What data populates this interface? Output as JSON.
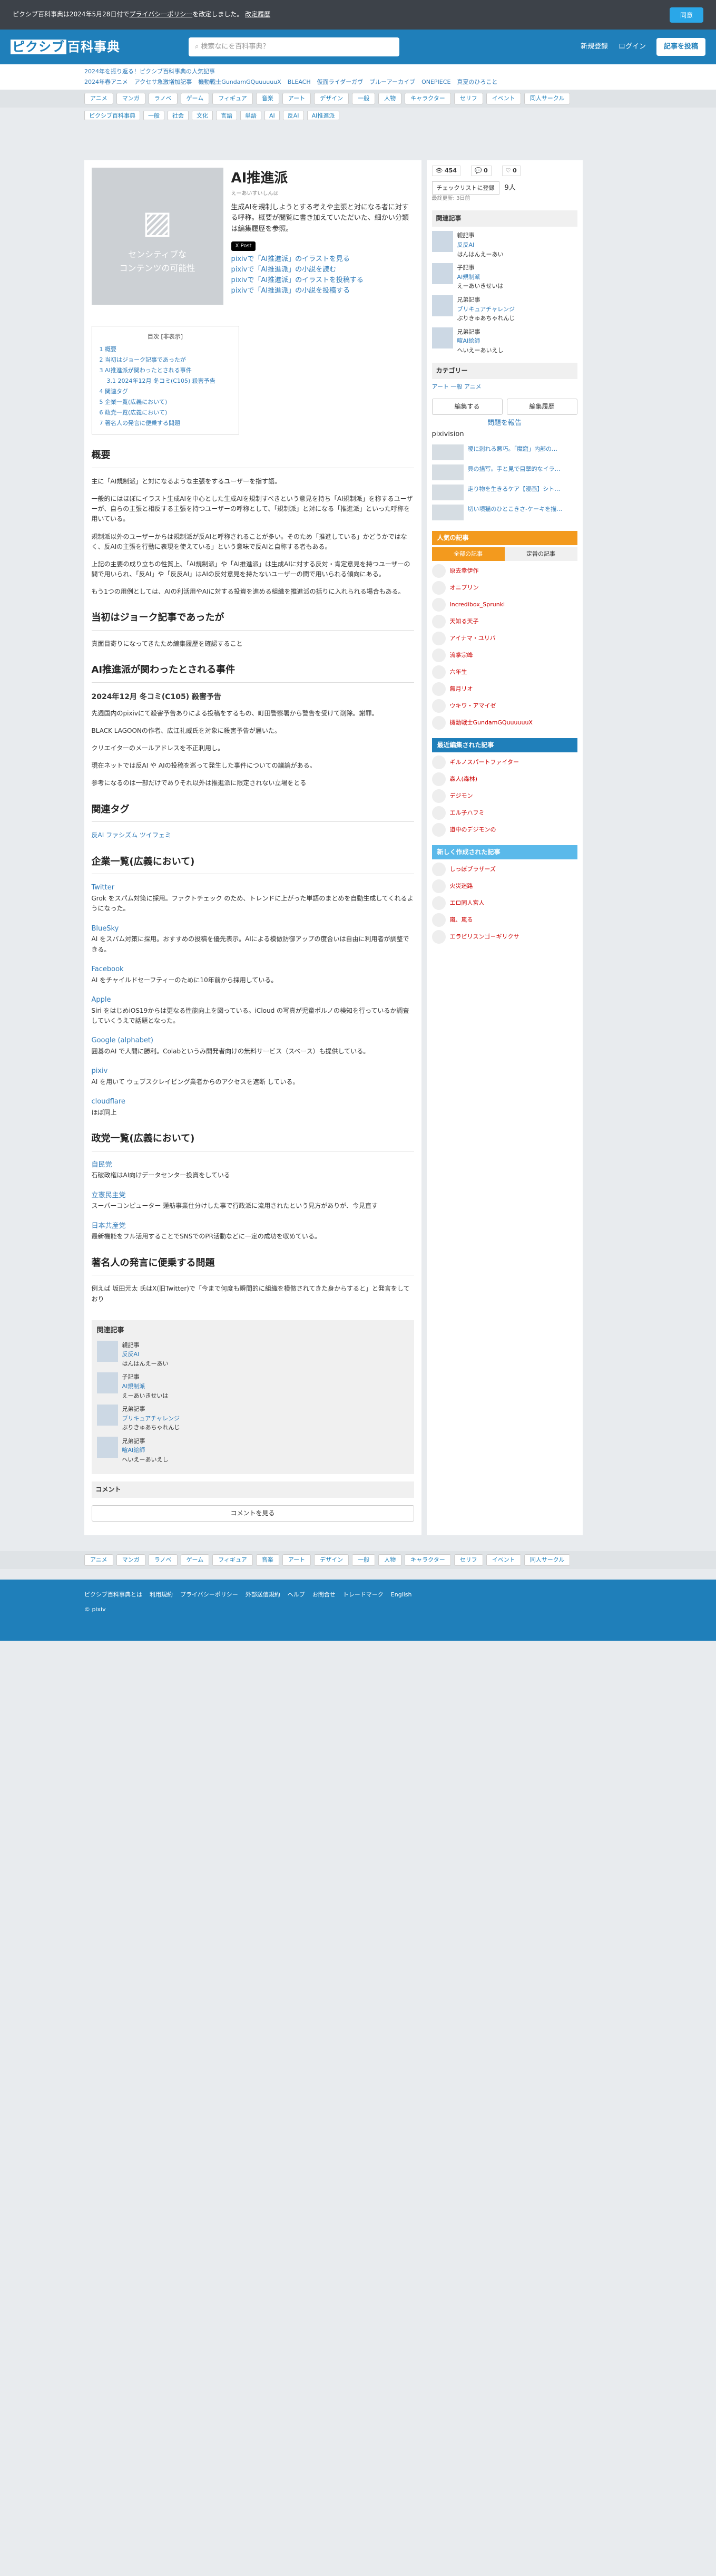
{
  "notice": {
    "text": "ピクシブ百科事典は2024年5月28日付で",
    "link": "プライバシーポリシー",
    "text2": "を改定しました。",
    "more": "改定履歴",
    "ok": "同意"
  },
  "header": {
    "logo": "ピクシブ百科事典",
    "search_placeholder": "検索なにを百科事典？",
    "login": "ログイン",
    "new": "新規登録",
    "register": "記事を投稿"
  },
  "promo": {
    "line1": "2024年を振り返る！ピクシブ百科事典の人気記事",
    "line2": [
      "2024年春アニメ",
      "アクセサ急激増加記事",
      "機動戦士GundamGQuuuuuuX",
      "BLEACH",
      "仮面ライダーガヴ",
      "ブルーアーカイブ",
      "ONEPIECE",
      "真夏のひろこと"
    ]
  },
  "nav": [
    "アニメ",
    "マンガ",
    "ラノベ",
    "ゲーム",
    "フィギュア",
    "音楽",
    "アート",
    "デザイン",
    "一般",
    "人物",
    "キャラクター",
    "セリフ",
    "イベント",
    "同人サークル"
  ],
  "breadcrumb": [
    "ピクシブ百科事典",
    "一般",
    "社会",
    "文化",
    "言語",
    "単語",
    "AI",
    "反AI",
    "AI推進派"
  ],
  "article": {
    "title": "AI推進派",
    "yomi": "えーあいすいしんは",
    "desc": "生成AIを規制しようとする考えや主張と対になる者に対する呼称。概要が閲覧に書き加えていただいた、細かい分類は編集履歴を参照。",
    "post": "X Post",
    "thumb": "センシティブな\nコンテンツの可能性",
    "links": [
      "pixivで「AI推進派」のイラストを見る",
      "pixivで「AI推進派」の小説を読む",
      "pixivで「AI推進派」のイラストを投稿する",
      "pixivで「AI推進派」の小説を投稿する"
    ]
  },
  "toc": {
    "title": "目次 [非表示]",
    "items": [
      "1 概要",
      "2 当初はジョーク記事であったが",
      "3 AI推進派が関わったとされる事件",
      "3.1 2024年12月 冬コミ(C105) 殺害予告",
      "4 関連タグ",
      "5 企業一覧(広義において)",
      "6 政党一覧(広義において)",
      "7 著名人の発言に便乗する問題"
    ]
  },
  "sections": {
    "s1": "概要",
    "s1p": [
      "主に「AI規制派」と対になるような主張をするユーザーを指す語。",
      "一般的にはほぼにイラスト生成AIを中心とした生成AIを規制すべきという意見を持ち「AI規制派」を称するユーザーが、自らの主張と相反する主張を持つユーザーの呼称として、「規制派」と対になる「推進派」といった呼称を用いている。",
      "規制派以外のユーザーからは規制派が反AIと呼称されることが多い。そのため「推進している」かどうかではなく、反AIの主張を行動に表現を使えている」という意味で反AIと自称する者もある。",
      "上記の主要の成り立ちの性質上、「AI規制派」や「AI推進派」は生成AIに対する反対・肯定意見を持つユーザーの間で用いられ、「反AI」や「反反AI」はAIの反対意見を持たないユーザーの間で用いられる傾向にある。",
      "もう1つの用例としては、AIの利活用やAIに対する投資を進める組織を推進派の括りに入れられる場合もある。"
    ],
    "s2": "当初はジョーク記事であったが",
    "s2p": "真面目寄りになってきたため編集履歴を確認すること",
    "s3": "AI推進派が関わったとされる事件",
    "s31": "2024年12月 冬コミ(C105) 殺害予告",
    "s3p": [
      "先週国内のpixivにて殺害予告ありによる投稿をするもの、町田警察署から警告を受けて削除。謝罪。",
      "BLACK LAGOONの作者、広江礼威氏を対象に殺害予告が届いた。",
      "クリエイターのメールアドレスを不正利用し。",
      "現在ネットでは反AI や AIの投稿を巡って発生した事件についての議論がある。",
      "参考になるのは一部だけでありそれ以外は推進派に限定されない立場をとる"
    ],
    "s4": "関連タグ",
    "s4p": "反AI ファシズム ツイフェミ",
    "s5": "企業一覧(広義において)",
    "s5items": [
      {
        "name": "Twitter",
        "text": "Grok をスパム対策に採用。ファクトチェック のため、トレンドに上がった単語のまとめを自動生成してくれるようになった。"
      },
      {
        "name": "BlueSky",
        "text": "AI をスパム対策に採用。おすすめの投稿を優先表示。AIによる模倣防御アップの度合いは自由に利用者が調整できる。"
      },
      {
        "name": "Facebook",
        "text": "AI をチャイルドセーフティーのために10年前から採用している。"
      },
      {
        "name": "Apple",
        "text": "Siri をはじめiOS19からは更なる性能向上を図っている。iCloud の写真が児童ポルノの検知を行っているか調査していくうえで話題となった。"
      },
      {
        "name": "Google (alphabet)",
        "text": "囲碁のAI で人間に勝利。Colabというみ開発者向けの無料サービス（スペース）も提供している。"
      },
      {
        "name": "pixiv",
        "text": "AI を用いて ウェブスクレイピング業者からのアクセスを遮断 している。"
      },
      {
        "name": "cloudflare",
        "text": "ほぼ同上"
      }
    ],
    "s6": "政党一覧(広義において)",
    "s6items": [
      {
        "name": "自民党",
        "text": "石破政権はAI向けデータセンター投資をしている"
      },
      {
        "name": "立憲民主党",
        "text": "スーパーコンピューター 蓮舫事業仕分けした事で行政派に流用されたという見方がありが、今見直す"
      },
      {
        "name": "日本共産党",
        "text": "最新機能をフル活用することでSNSでのPR活動などに一定の成功を収めている。"
      }
    ],
    "s7": "著名人の発言に便乗する問題",
    "s7p": "例えば 坂田元太 氏はX(旧Twitter)で「今まで何度も瞬間的に組織を模倣されてきた身からすると」と発言をしており"
  },
  "related": {
    "title": "関連記事",
    "items": [
      {
        "tag": "親記事",
        "name": "反反AI",
        "yomi": "はんはんえーあい"
      },
      {
        "tag": "子記事",
        "name": "AI規制派",
        "yomi": "えーあいきせいは"
      },
      {
        "tag": "兄弟記事",
        "name": "ブリキュアチャレンジ",
        "yomi": "ぶりきゅあちゃれんじ"
      },
      {
        "tag": "兄弟記事",
        "name": "喧AI絵師",
        "yomi": "へいえーあいえし"
      }
    ]
  },
  "comment": {
    "title": "コメント",
    "btn": "コメントを見る"
  },
  "side": {
    "views": "454",
    "comments": "0",
    "likes": "0",
    "watch": "チェックリストに登録",
    "watch_count": "9人",
    "updated": "最終更新",
    "date": "3日前",
    "related": "関連記事",
    "cat": "カテゴリー",
    "cats": [
      "アート",
      "一般",
      "アニメ"
    ],
    "edit": "編集する",
    "history": "編集履歴",
    "report": "問題を報告",
    "pixivision": "pixivision",
    "pv": [
      "曖に刺れる悪巧。「魔窟」内部の…",
      "貝の描写。手と見で目撃的なイラ…",
      "走り物を生きるケア【漫画】シト…",
      "切い頃猫のひとこきさ-ケーキを描…"
    ],
    "popular": "人気の記事",
    "ptabs": [
      "全部の記事",
      "定番の記事"
    ],
    "ranking": [
      "原去幸伊作",
      "オニプリン",
      "Incredibox_Sprunki",
      "天知る天子",
      "アイナマ・ユリバ",
      "流拳宗峰",
      "六年生",
      "無月リオ",
      "ウキワ・アマイゼ",
      "機動戦士GundamGQuuuuuuX"
    ],
    "recent": "最近編集された記事",
    "recent_items": [
      "ギルノスパートファイター",
      "森人(森林)",
      "デジモン",
      "エル子ハフミ",
      "道中のデジモンの"
    ],
    "new": "新しく作成された記事",
    "new_items": [
      "しっぽブラザーズ",
      "火災迷路",
      "エロ同人宮人",
      "嵐、嵐る",
      "エラビリスンゴ－ギリクサ"
    ]
  },
  "footer": {
    "btm": [
      "ピクシブ百科事典とは",
      "利用規約",
      "プライバシーポリシー",
      "外部送信規約",
      "ヘルプ",
      "お問合せ",
      "トレードマーク",
      "English"
    ],
    "copy": "© pixiv"
  }
}
